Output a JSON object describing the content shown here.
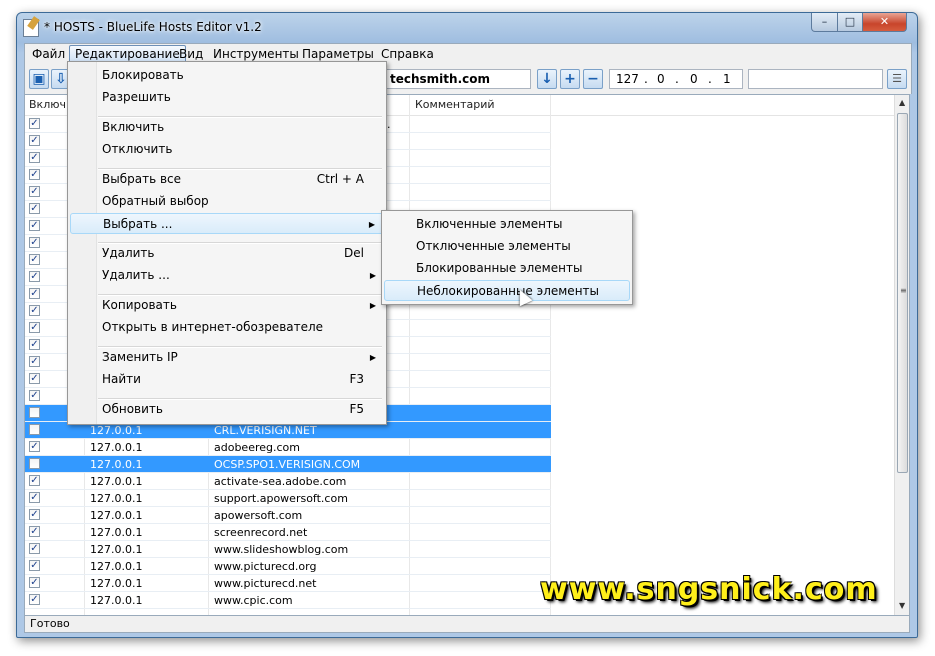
{
  "window": {
    "title": "* HOSTS - BlueLife Hosts Editor v1.2",
    "min": "–",
    "max": "□",
    "close": "✕"
  },
  "menu": [
    "Файл",
    "Редактирование",
    "Вид",
    "Инструменты",
    "Параметры",
    "Справка"
  ],
  "toolbar": {
    "domain_value": "techsmith.com",
    "ip_parts": [
      "127",
      ".",
      "0",
      ".",
      "0",
      ".",
      "1"
    ],
    "comment_value": ""
  },
  "columns": {
    "enabled": "Включ.",
    "comment": "Комментарий"
  },
  "rows": [
    {
      "checked": true,
      "ip": "",
      "host": "...",
      "sel": false
    },
    {
      "checked": true,
      "ip": "",
      "host": "",
      "sel": false
    },
    {
      "checked": true,
      "ip": "",
      "host": "",
      "sel": false
    },
    {
      "checked": true,
      "ip": "",
      "host": "",
      "sel": false
    },
    {
      "checked": true,
      "ip": "",
      "host": "",
      "sel": false
    },
    {
      "checked": true,
      "ip": "",
      "host": "",
      "sel": false
    },
    {
      "checked": true,
      "ip": "",
      "host": "",
      "sel": false
    },
    {
      "checked": true,
      "ip": "",
      "host": "",
      "sel": false
    },
    {
      "checked": true,
      "ip": "",
      "host": "",
      "sel": false
    },
    {
      "checked": true,
      "ip": "",
      "host": "",
      "sel": false
    },
    {
      "checked": true,
      "ip": "",
      "host": "",
      "sel": false
    },
    {
      "checked": true,
      "ip": "",
      "host": "",
      "sel": false
    },
    {
      "checked": true,
      "ip": "",
      "host": "",
      "sel": false
    },
    {
      "checked": true,
      "ip": "",
      "host": "",
      "sel": false
    },
    {
      "checked": true,
      "ip": "",
      "host": "",
      "sel": false
    },
    {
      "checked": true,
      "ip": "",
      "host": "",
      "sel": false
    },
    {
      "checked": true,
      "ip": "",
      "host": "",
      "sel": false
    },
    {
      "checked": false,
      "ip": "",
      "host": "",
      "sel": true
    },
    {
      "checked": false,
      "ip": "127.0.0.1",
      "host": "CRL.VERISIGN.NET",
      "sel": true
    },
    {
      "checked": true,
      "ip": "127.0.0.1",
      "host": "adobeereg.com",
      "sel": false
    },
    {
      "checked": false,
      "ip": "127.0.0.1",
      "host": "OCSP.SPO1.VERISIGN.COM",
      "sel": true
    },
    {
      "checked": true,
      "ip": "127.0.0.1",
      "host": "activate-sea.adobe.com",
      "sel": false
    },
    {
      "checked": true,
      "ip": "127.0.0.1",
      "host": "support.apowersoft.com",
      "sel": false
    },
    {
      "checked": true,
      "ip": "127.0.0.1",
      "host": "apowersoft.com",
      "sel": false
    },
    {
      "checked": true,
      "ip": "127.0.0.1",
      "host": "screenrecord.net",
      "sel": false
    },
    {
      "checked": true,
      "ip": "127.0.0.1",
      "host": "www.slideshowblog.com",
      "sel": false
    },
    {
      "checked": true,
      "ip": "127.0.0.1",
      "host": "www.picturecd.org",
      "sel": false
    },
    {
      "checked": true,
      "ip": "127.0.0.1",
      "host": "www.picturecd.net",
      "sel": false
    },
    {
      "checked": true,
      "ip": "127.0.0.1",
      "host": "www.cpic.com",
      "sel": false
    }
  ],
  "dropdown": {
    "items": [
      {
        "label": "Блокировать",
        "shortcut": "",
        "arrow": false,
        "hl": false,
        "name": "menu-block"
      },
      {
        "label": "Разрешить",
        "shortcut": "",
        "arrow": false,
        "hl": false,
        "name": "menu-allow"
      },
      {
        "label": "Включить",
        "shortcut": "",
        "arrow": false,
        "hl": false,
        "name": "menu-enable"
      },
      {
        "label": "Отключить",
        "shortcut": "",
        "arrow": false,
        "hl": false,
        "name": "menu-disable"
      },
      {
        "label": "Выбрать все",
        "shortcut": "Ctrl + A",
        "arrow": false,
        "hl": false,
        "name": "menu-select-all"
      },
      {
        "label": "Обратный выбор",
        "shortcut": "",
        "arrow": false,
        "hl": false,
        "name": "menu-invert-selection"
      },
      {
        "label": "Выбрать ...",
        "shortcut": "",
        "arrow": true,
        "hl": true,
        "name": "menu-select-submenu"
      },
      {
        "label": "Удалить",
        "shortcut": "Del",
        "arrow": false,
        "hl": false,
        "name": "menu-delete"
      },
      {
        "label": "Удалить ...",
        "shortcut": "",
        "arrow": true,
        "hl": false,
        "name": "menu-delete-submenu"
      },
      {
        "label": "Копировать",
        "shortcut": "",
        "arrow": true,
        "hl": false,
        "name": "menu-copy"
      },
      {
        "label": "Открыть в интернет-обозревателе",
        "shortcut": "",
        "arrow": false,
        "hl": false,
        "name": "menu-open-browser"
      },
      {
        "label": "Заменить IP",
        "shortcut": "",
        "arrow": true,
        "hl": false,
        "name": "menu-replace-ip"
      },
      {
        "label": "Найти",
        "shortcut": "F3",
        "arrow": false,
        "hl": false,
        "name": "menu-find"
      },
      {
        "label": "Обновить",
        "shortcut": "F5",
        "arrow": false,
        "hl": false,
        "name": "menu-refresh"
      }
    ]
  },
  "submenu": {
    "items": [
      "Включенные элементы",
      "Отключенные элементы",
      "Блокированные элементы",
      "Неблокированные элементы"
    ]
  },
  "status": "Готово",
  "watermark": "www.sngsnick.com"
}
